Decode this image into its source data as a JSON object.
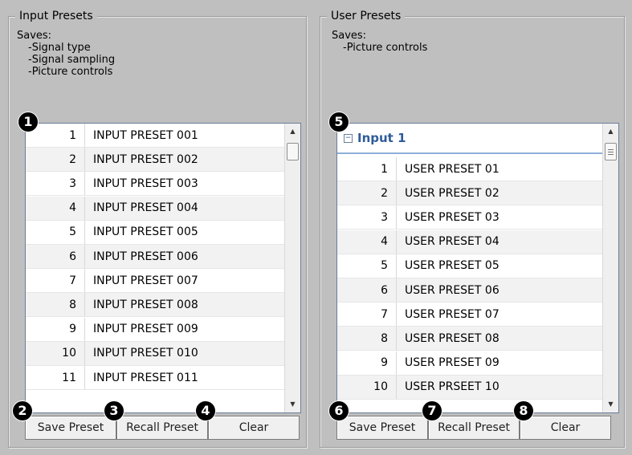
{
  "input_presets": {
    "title": "Input Presets",
    "saves_label": "Saves:",
    "saves_items": [
      "-Signal type",
      "-Signal sampling",
      "-Picture controls"
    ],
    "rows": [
      {
        "num": "1",
        "name": "INPUT PRESET 001"
      },
      {
        "num": "2",
        "name": "INPUT PRESET 002"
      },
      {
        "num": "3",
        "name": "INPUT PRESET 003"
      },
      {
        "num": "4",
        "name": "INPUT PRESET 004"
      },
      {
        "num": "5",
        "name": "INPUT PRESET 005"
      },
      {
        "num": "6",
        "name": "INPUT PRESET 006"
      },
      {
        "num": "7",
        "name": "INPUT PRESET 007"
      },
      {
        "num": "8",
        "name": "INPUT PRESET 008"
      },
      {
        "num": "9",
        "name": "INPUT PRESET 009"
      },
      {
        "num": "10",
        "name": "INPUT PRESET 010"
      },
      {
        "num": "11",
        "name": "INPUT PRESET 011"
      }
    ],
    "buttons": {
      "save": "Save Preset",
      "recall": "Recall Preset",
      "clear": "Clear"
    }
  },
  "user_presets": {
    "title": "User Presets",
    "saves_label": "Saves:",
    "saves_items": [
      "-Picture controls"
    ],
    "group_label": "Input 1",
    "expander_symbol": "−",
    "rows": [
      {
        "num": "1",
        "name": "USER PRESET 01"
      },
      {
        "num": "2",
        "name": "USER PRESET 02"
      },
      {
        "num": "3",
        "name": "USER PRESET 03"
      },
      {
        "num": "4",
        "name": "USER PRESET 04"
      },
      {
        "num": "5",
        "name": "USER PRESET 05"
      },
      {
        "num": "6",
        "name": "USER PRESET 06"
      },
      {
        "num": "7",
        "name": "USER PRESET 07"
      },
      {
        "num": "8",
        "name": "USER PRESET 08"
      },
      {
        "num": "9",
        "name": "USER PRESET 09"
      },
      {
        "num": "10",
        "name": "USER PRSEET 10"
      }
    ],
    "buttons": {
      "save": "Save Preset",
      "recall": "Recall Preset",
      "clear": "Clear"
    }
  },
  "callouts": [
    "1",
    "2",
    "3",
    "4",
    "5",
    "6",
    "7",
    "8"
  ],
  "scroll_arrows": {
    "up": "▲",
    "down": "▼"
  },
  "colors": {
    "background": "#bfbfbf",
    "list_border": "#6b7d99",
    "group_header_text": "#2e5b9a",
    "group_header_rule": "#8fb0d8"
  }
}
